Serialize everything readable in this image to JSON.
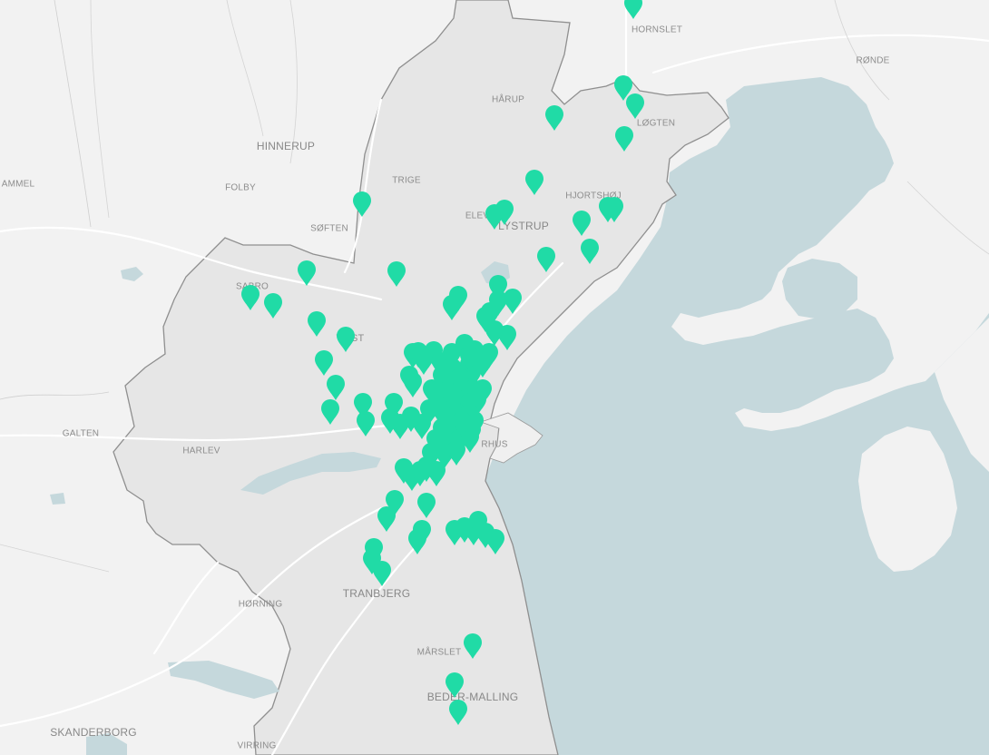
{
  "map": {
    "colors": {
      "background": "#f2f2f2",
      "municipality_fill": "#e6e6e6",
      "municipality_border": "#8f8f8f",
      "water": "#c5d8dc",
      "roads": "#ffffff",
      "marker": "#20dba6"
    },
    "marker_icon": "map-pin-icon",
    "places": [
      {
        "id": "hornslet",
        "name": "HORNSLET",
        "size": "small"
      },
      {
        "id": "ronde",
        "name": "RØNDE",
        "size": "small"
      },
      {
        "id": "harup",
        "name": "HÅRUP",
        "size": "small"
      },
      {
        "id": "logten",
        "name": "LØGTEN",
        "size": "small"
      },
      {
        "id": "hinnerup",
        "name": "HINNERUP",
        "size": "big"
      },
      {
        "id": "ammel",
        "name": "AMMEL",
        "size": "small"
      },
      {
        "id": "folby",
        "name": "FOLBY",
        "size": "small"
      },
      {
        "id": "trige",
        "name": "TRIGE",
        "size": "small"
      },
      {
        "id": "hjortshoj",
        "name": "HJORTSHØJ",
        "size": "small"
      },
      {
        "id": "elev",
        "name": "ELEV",
        "size": "small"
      },
      {
        "id": "lystrup",
        "name": "LYSTRUP",
        "size": "big"
      },
      {
        "id": "soften",
        "name": "SØFTEN",
        "size": "small"
      },
      {
        "id": "sabro",
        "name": "SABRO",
        "size": "small"
      },
      {
        "id": "tilst",
        "name": "TILST",
        "size": "mid"
      },
      {
        "id": "galten",
        "name": "GALTEN",
        "size": "small"
      },
      {
        "id": "harlev",
        "name": "HARLEV",
        "size": "small"
      },
      {
        "id": "aarhus",
        "name": "RHUS",
        "size": "small"
      },
      {
        "id": "horning",
        "name": "HØRNING",
        "size": "small"
      },
      {
        "id": "tranbjerg",
        "name": "TRANBJERG",
        "size": "big"
      },
      {
        "id": "marslet",
        "name": "MÅRSLET",
        "size": "small"
      },
      {
        "id": "beder",
        "name": "BEDER-MALLING",
        "size": "big"
      },
      {
        "id": "skanderborg",
        "name": "SKANDERBORG",
        "size": "big"
      },
      {
        "id": "virring",
        "name": "VIRRING",
        "size": "small"
      }
    ],
    "marker_count": 150
  }
}
